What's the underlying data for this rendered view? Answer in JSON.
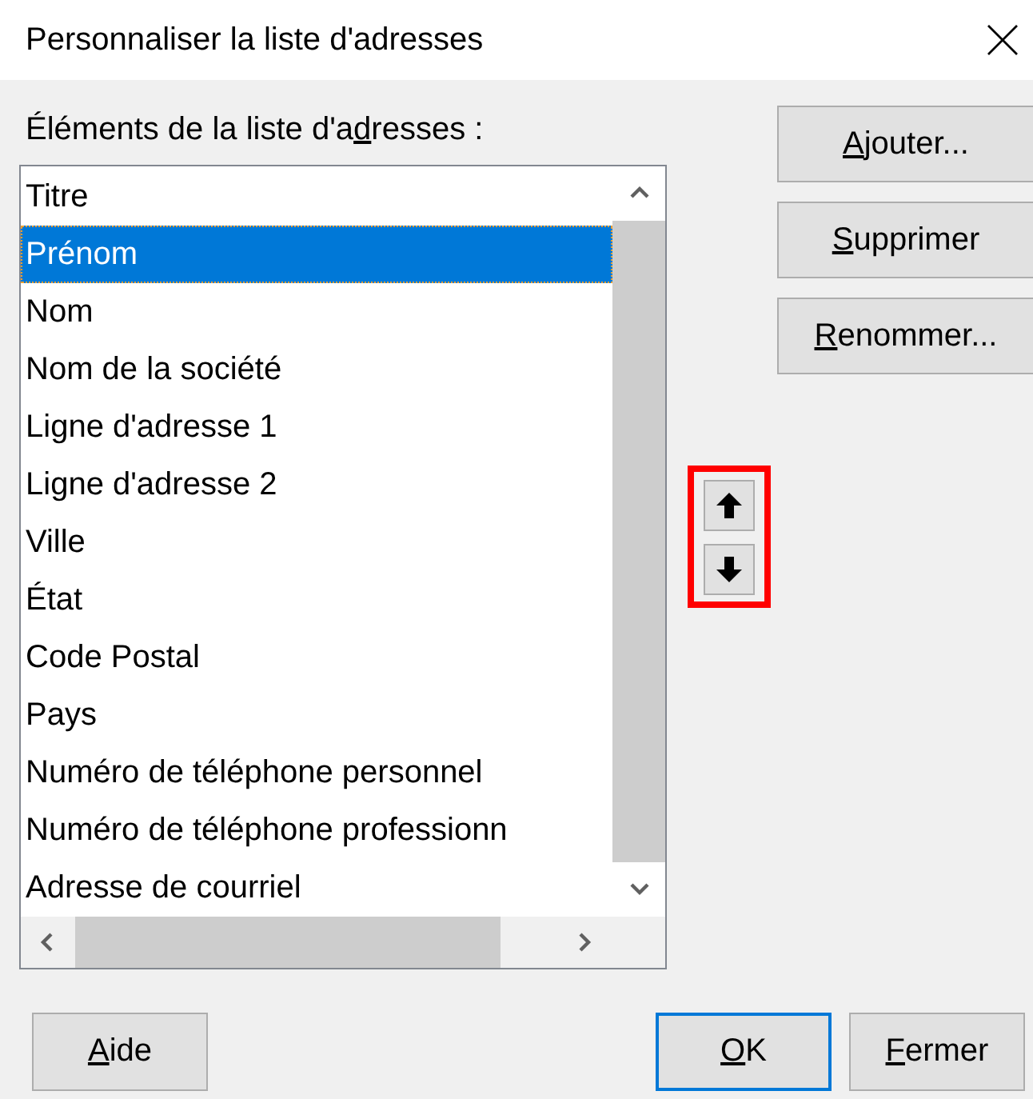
{
  "window": {
    "title": "Personnaliser la liste d'adresses"
  },
  "list": {
    "label": {
      "before": "Éléments de la liste d'a",
      "mnemonic": "d",
      "after": "resses :"
    },
    "items": [
      {
        "text": "Titre",
        "selected": false
      },
      {
        "text": "Prénom",
        "selected": true
      },
      {
        "text": "Nom",
        "selected": false
      },
      {
        "text": "Nom de la société",
        "selected": false
      },
      {
        "text": "Ligne d'adresse 1",
        "selected": false
      },
      {
        "text": "Ligne d'adresse 2",
        "selected": false
      },
      {
        "text": "Ville",
        "selected": false
      },
      {
        "text": "État",
        "selected": false
      },
      {
        "text": "Code Postal",
        "selected": false
      },
      {
        "text": "Pays",
        "selected": false
      },
      {
        "text": "Numéro de téléphone personnel",
        "selected": false
      },
      {
        "text": "Numéro de téléphone professionn",
        "selected": false
      },
      {
        "text": "Adresse de courriel",
        "selected": false
      }
    ]
  },
  "move_buttons": [
    {
      "kind": "up"
    },
    {
      "kind": "down"
    }
  ],
  "side_buttons": [
    {
      "mnemonic": "A",
      "after": "jouter..."
    },
    {
      "mnemonic": "S",
      "after": "upprimer"
    },
    {
      "mnemonic": "R",
      "after": "enommer..."
    }
  ],
  "footer_buttons": [
    {
      "mnemonic": "A",
      "after": "ide",
      "default": false,
      "kind": "help"
    },
    {
      "mnemonic": "O",
      "after": "K",
      "default": true,
      "kind": "action"
    },
    {
      "mnemonic": "F",
      "after": "ermer",
      "default": false,
      "kind": "action"
    }
  ]
}
